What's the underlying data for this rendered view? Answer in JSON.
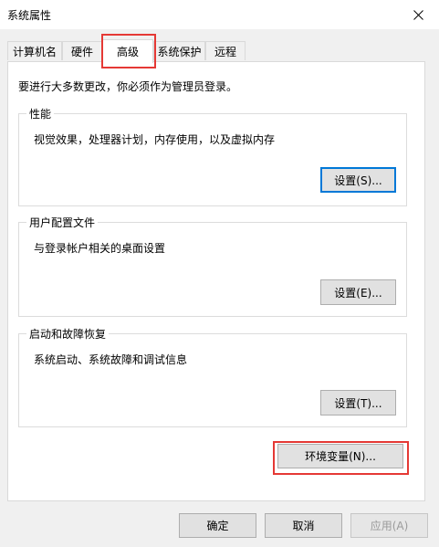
{
  "window": {
    "title": "系统属性"
  },
  "tabs": [
    {
      "label": "计算机名"
    },
    {
      "label": "硬件"
    },
    {
      "label": "高级"
    },
    {
      "label": "系统保护"
    },
    {
      "label": "远程"
    }
  ],
  "intro": "要进行大多数更改，你必须作为管理员登录。",
  "groups": {
    "performance": {
      "title": "性能",
      "desc": "视觉效果，处理器计划，内存使用，以及虚拟内存",
      "button": "设置(S)..."
    },
    "user_profiles": {
      "title": "用户配置文件",
      "desc": "与登录帐户相关的桌面设置",
      "button": "设置(E)..."
    },
    "startup": {
      "title": "启动和故障恢复",
      "desc": "系统启动、系统故障和调试信息",
      "button": "设置(T)..."
    }
  },
  "env_button": "环境变量(N)...",
  "footer": {
    "ok": "确定",
    "cancel": "取消",
    "apply": "应用(A)"
  },
  "colors": {
    "highlight": "#e53935",
    "focus": "#0078d7"
  }
}
